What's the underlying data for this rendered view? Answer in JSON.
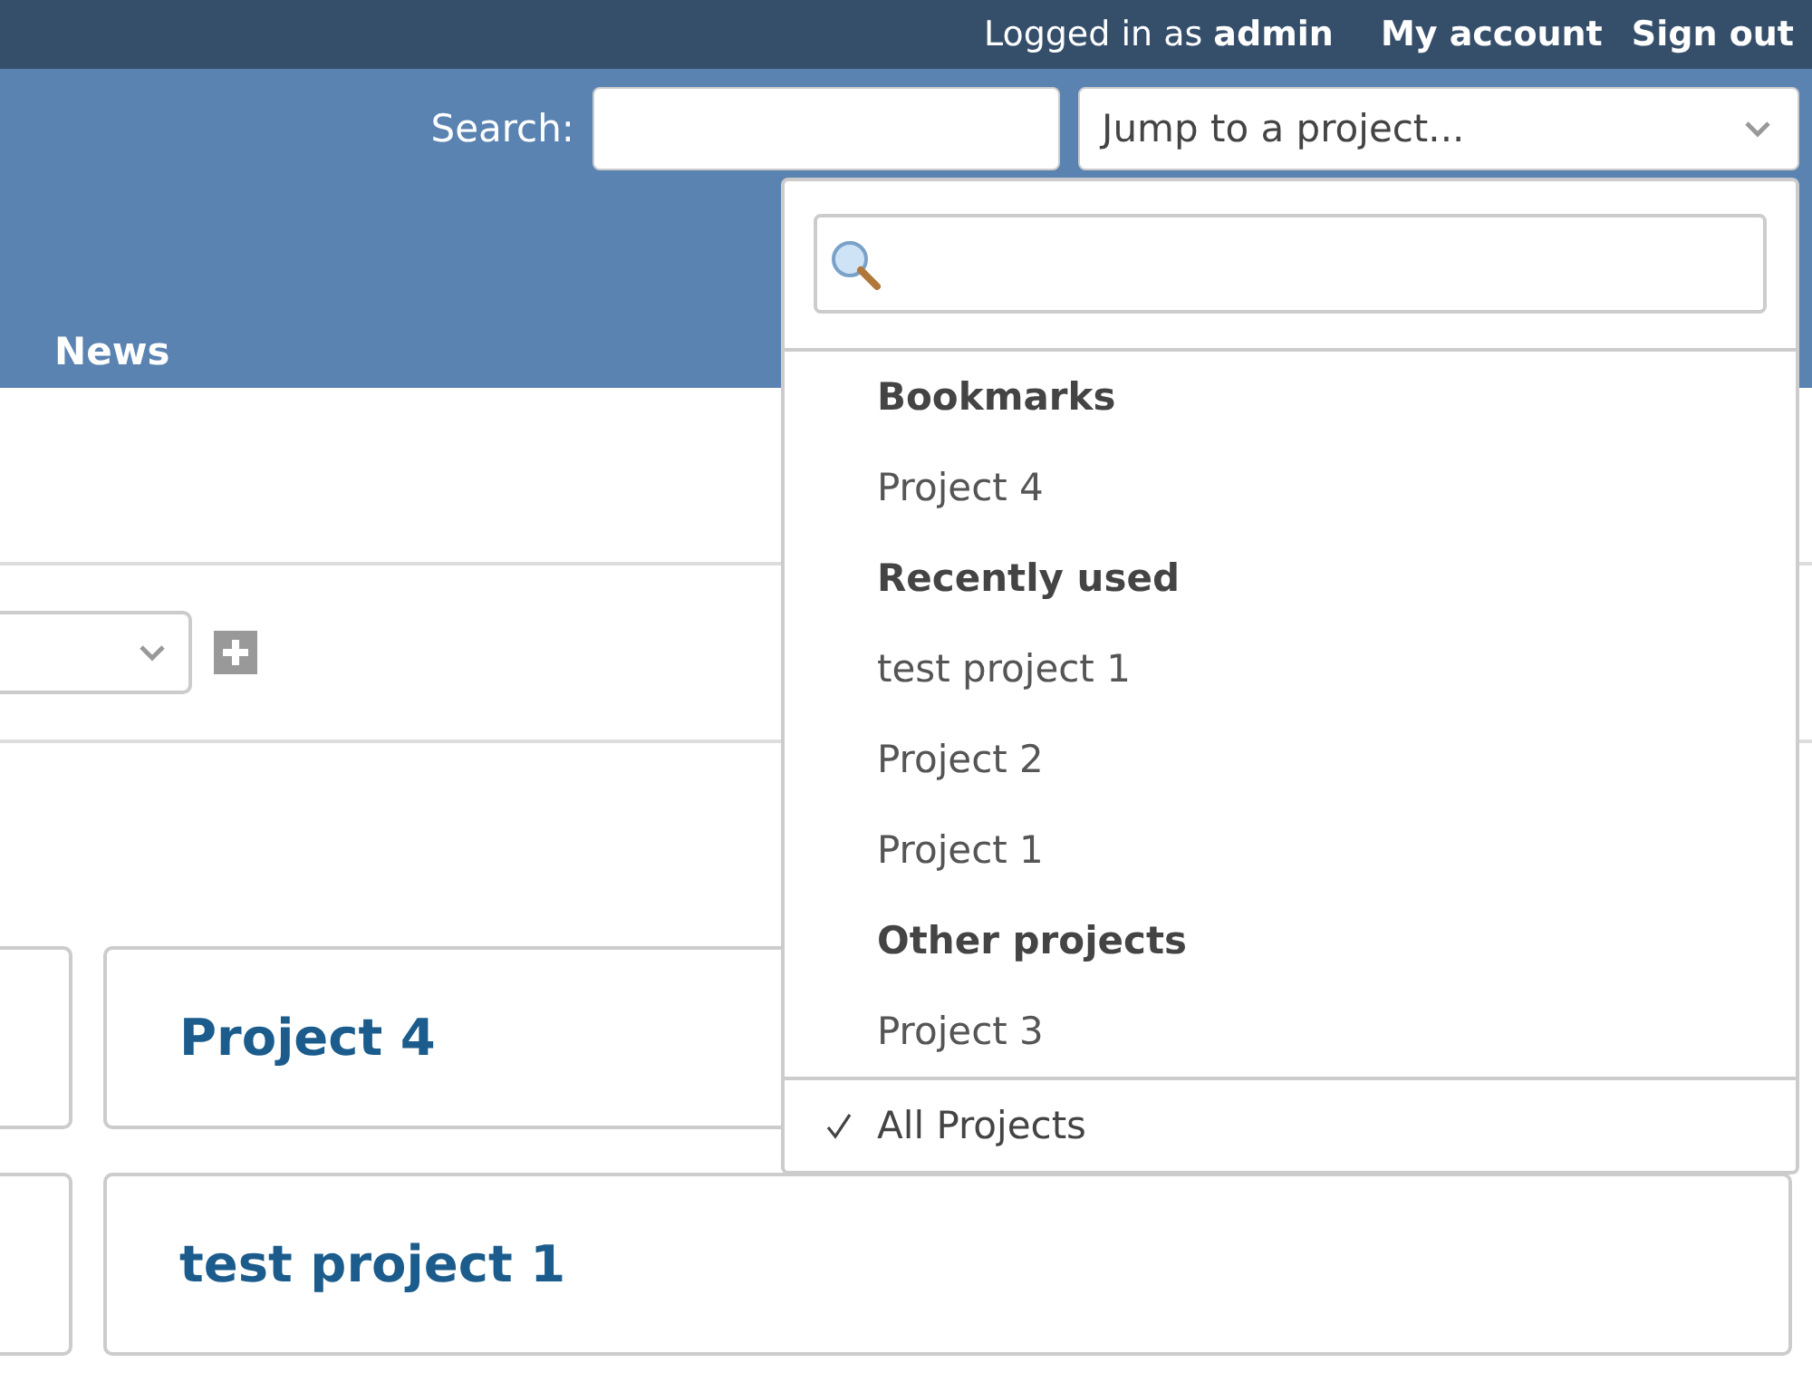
{
  "top_menu": {
    "logged_in": "Logged in as **admin**",
    "links": [
      "My account",
      "Sign out"
    ]
  },
  "header": {
    "search_label": "Search:",
    "project_jump": {
      "placeholder": "Jump to a project..."
    },
    "main_menu": [
      "News"
    ]
  },
  "content": {
    "cards": [
      {
        "title": "Project 4"
      },
      {
        "title": "test project 1"
      }
    ]
  },
  "project_dropdown": {
    "groups": [
      {
        "heading": "Bookmarks",
        "items": [
          {
            "label": "Project 4",
            "selected": false
          }
        ]
      },
      {
        "heading": "Recently used",
        "items": [
          {
            "label": "test project 1",
            "selected": false
          },
          {
            "label": "Project 2",
            "selected": false
          },
          {
            "label": "Project 1",
            "selected": false
          }
        ]
      },
      {
        "heading": "Other projects",
        "items": [
          {
            "label": "Project 3",
            "selected": false
          }
        ]
      }
    ],
    "all_projects": {
      "label": "All Projects",
      "selected": true
    }
  }
}
